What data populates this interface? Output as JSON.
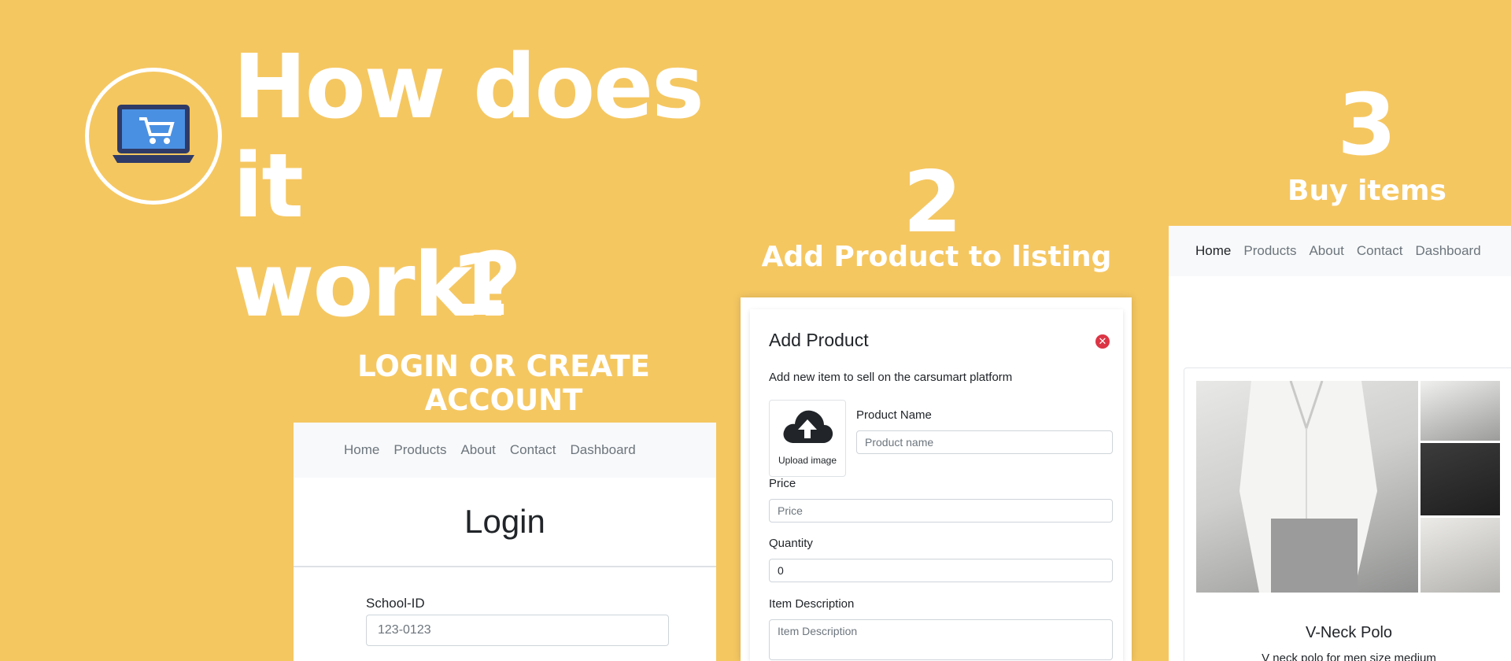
{
  "headline": {
    "line1": "How does it",
    "line2": "work?"
  },
  "steps": [
    {
      "number": "1",
      "title": "LOGIN OR CREATE ACCOUNT"
    },
    {
      "number": "2",
      "title": "Add Product to listing"
    },
    {
      "number": "3",
      "title": "Buy items"
    }
  ],
  "nav": {
    "items": [
      "Home",
      "Products",
      "About",
      "Contact",
      "Dashboard"
    ]
  },
  "login": {
    "title": "Login",
    "school_id_label": "School-ID",
    "school_id_placeholder": "123-0123"
  },
  "add_product": {
    "title": "Add Product",
    "close_icon": "close-icon",
    "subtitle": "Add new item to sell on the carsumart platform",
    "upload_label": "Upload image",
    "product_name_label": "Product Name",
    "product_name_placeholder": "Product name",
    "price_label": "Price",
    "price_placeholder": "Price",
    "quantity_label": "Quantity",
    "quantity_value": "0",
    "description_label": "Item Description",
    "description_placeholder": "Item Description"
  },
  "product_card": {
    "name": "V-Neck Polo",
    "description": "V neck polo for men size medium"
  },
  "colors": {
    "background": "#F5C761",
    "close": "#dc3545"
  }
}
